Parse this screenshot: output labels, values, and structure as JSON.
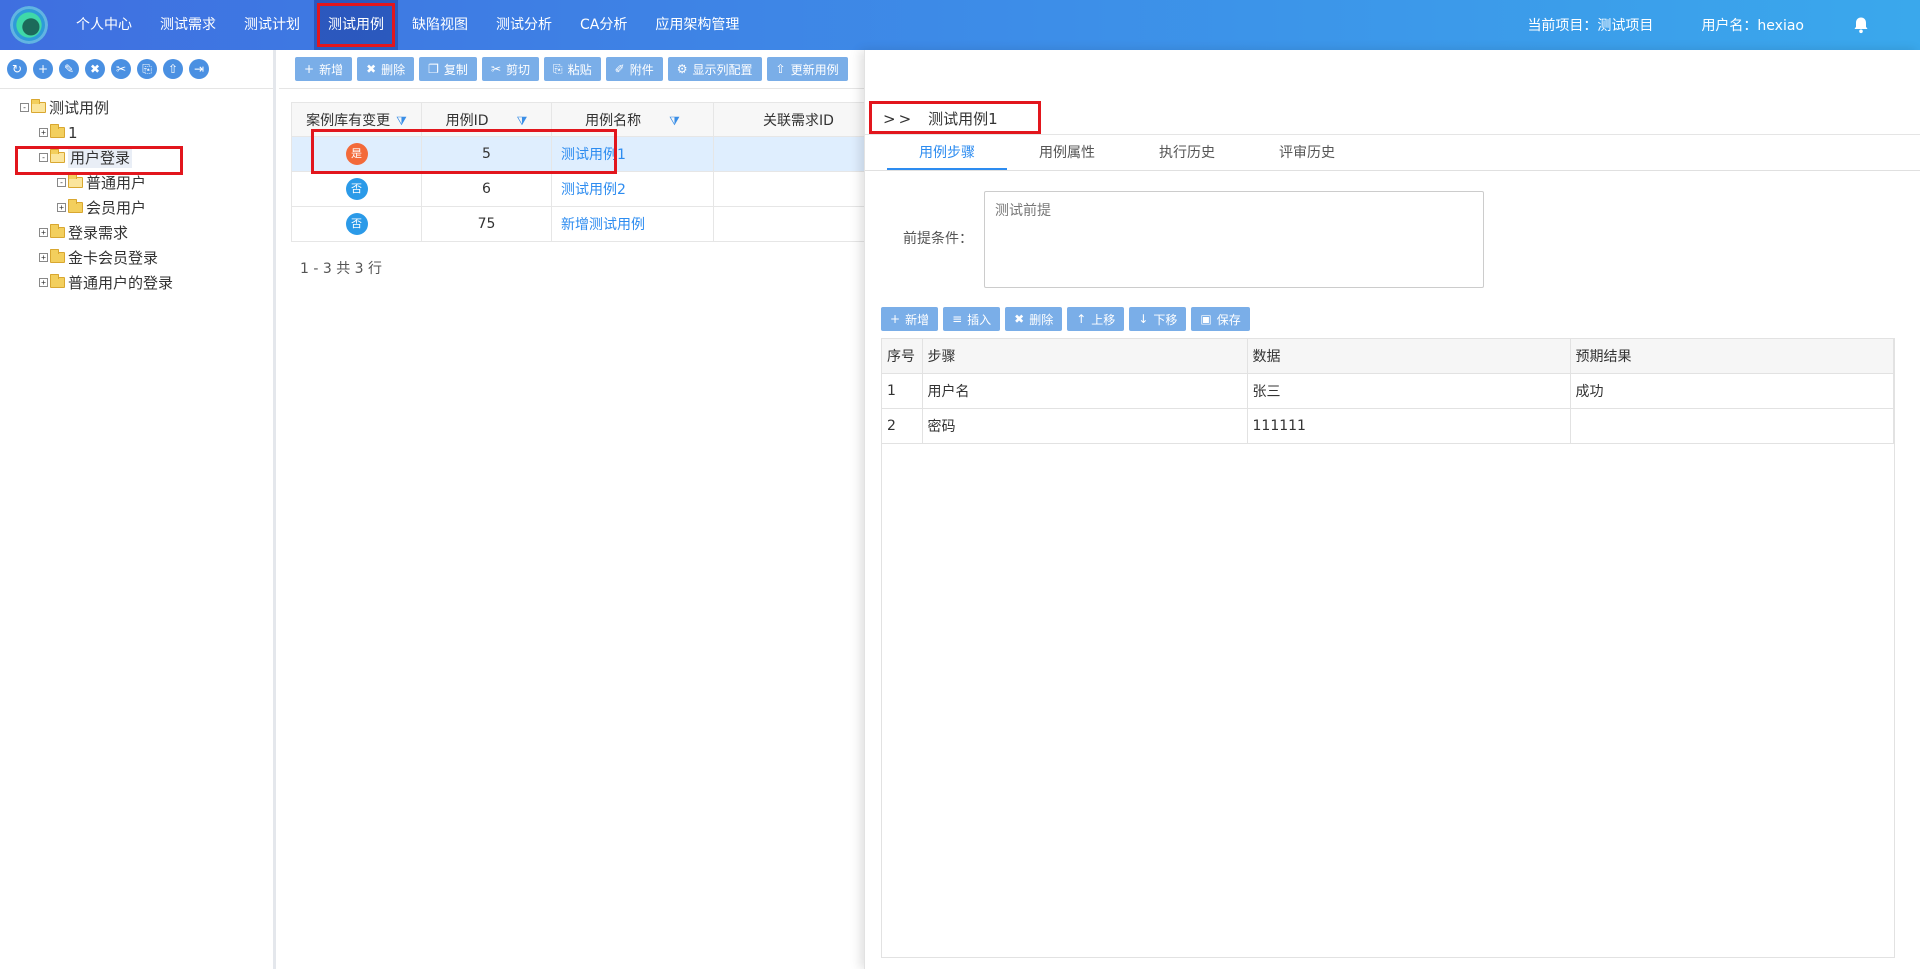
{
  "nav": {
    "items": [
      "个人中心",
      "测试需求",
      "测试计划",
      "测试用例",
      "缺陷视图",
      "测试分析",
      "CA分析",
      "应用架构管理"
    ],
    "current_project": "当前项目：测试项目",
    "username": "用户名：hexiao"
  },
  "tree_toolbar": {
    "icons": [
      "refresh-icon",
      "add-icon",
      "edit-icon",
      "delete-icon",
      "cut-icon",
      "paste-icon",
      "export-icon",
      "import-icon"
    ]
  },
  "tree": {
    "root": "测试用例",
    "n1": "1",
    "n2": "用户登录",
    "n2a": "普通用户",
    "n2b": "会员用户",
    "n3": "登录需求",
    "n4": "金卡会员登录",
    "n5": "普通用户的登录"
  },
  "toolbar": {
    "add": "新增",
    "delete": "删除",
    "copy": "复制",
    "cut": "剪切",
    "paste": "粘贴",
    "attach": "附件",
    "columns": "显示列配置",
    "update": "更新用例"
  },
  "grid": {
    "headers": [
      "案例库有变更",
      "用例ID",
      "用例名称",
      "关联需求ID"
    ],
    "rows": [
      {
        "changed": "是",
        "id": "5",
        "name": "测试用例1",
        "req": ""
      },
      {
        "changed": "否",
        "id": "6",
        "name": "测试用例2",
        "req": ""
      },
      {
        "changed": "否",
        "id": "75",
        "name": "新增测试用例",
        "req": ""
      }
    ],
    "pager": "1 - 3 共 3 行"
  },
  "detail": {
    "prefix": ">>",
    "title": "测试用例1",
    "tabs": [
      "用例步骤",
      "用例属性",
      "执行历史",
      "评审历史"
    ],
    "precondition_label": "前提条件：",
    "precondition_value": "测试前提",
    "step_toolbar": {
      "add": "新增",
      "insert": "插入",
      "delete": "删除",
      "up": "上移",
      "down": "下移",
      "save": "保存"
    },
    "step_headers": [
      "序号",
      "步骤",
      "数据",
      "预期结果"
    ],
    "steps": [
      {
        "no": "1",
        "step": "用户名",
        "data": "张三",
        "expected": "成功"
      },
      {
        "no": "2",
        "step": "密码",
        "data": "111111",
        "expected": ""
      }
    ]
  },
  "colors": {
    "accent": "#2d8cf0",
    "button": "#7aaee8",
    "highlight": "#e2161d",
    "badge_yes": "#f36a3a",
    "badge_no": "#2b9ae8"
  }
}
